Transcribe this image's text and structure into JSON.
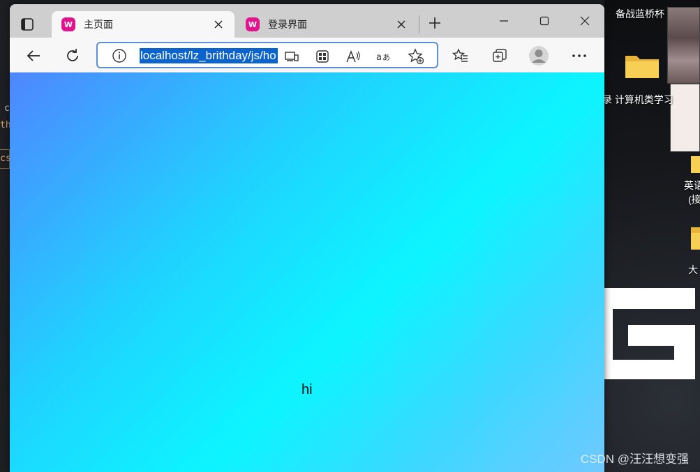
{
  "browser": {
    "tabs": [
      {
        "title": "主页面",
        "favicon": "W",
        "active": true
      },
      {
        "title": "登录界面",
        "favicon": "W",
        "active": false
      }
    ],
    "address": {
      "url": "localhost/lz_brithday/js/ho"
    },
    "window_controls": {
      "minimize": "minimize-icon",
      "maximize": "maximize-icon",
      "close": "close-icon"
    }
  },
  "page": {
    "text": "hi",
    "gradient_colors": [
      "#4f86ff",
      "#0cf5ff",
      "#70c8ff"
    ]
  },
  "desktop": {
    "labels": [
      "备战蓝桥杯",
      "计算机类学习",
      "英语",
      "(接",
      "大"
    ],
    "left_fragments": [
      "c",
      "th",
      "cs"
    ],
    "left_partial_char": "录"
  },
  "watermark": "CSDN @汪汪想变强"
}
